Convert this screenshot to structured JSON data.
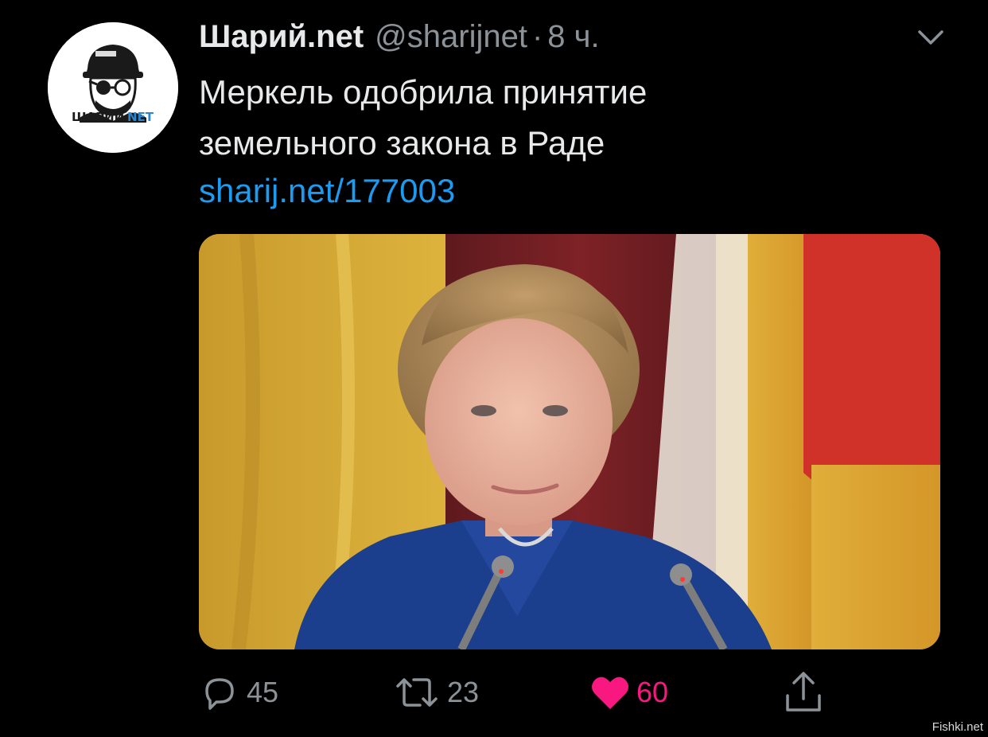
{
  "tweet": {
    "display_name": "Шарий.net",
    "handle": "@sharijnet",
    "separator": "·",
    "time": "8 ч.",
    "text_lines": [
      "Меркель одобрила принятие",
      "земельного закона в Раде"
    ],
    "link": "sharij.net/177003",
    "avatar_logo_text": "ШАРИЙ.NET",
    "menu_icon": "chevron-down-icon"
  },
  "actions": {
    "replies": "45",
    "retweets": "23",
    "likes": "60",
    "liked": true
  },
  "watermark": "Fishki.net",
  "colors": {
    "background": "#000000",
    "text": "#e7e9ea",
    "secondary_text": "#8b9298",
    "link": "#1d9bf0",
    "like": "#f91880"
  }
}
